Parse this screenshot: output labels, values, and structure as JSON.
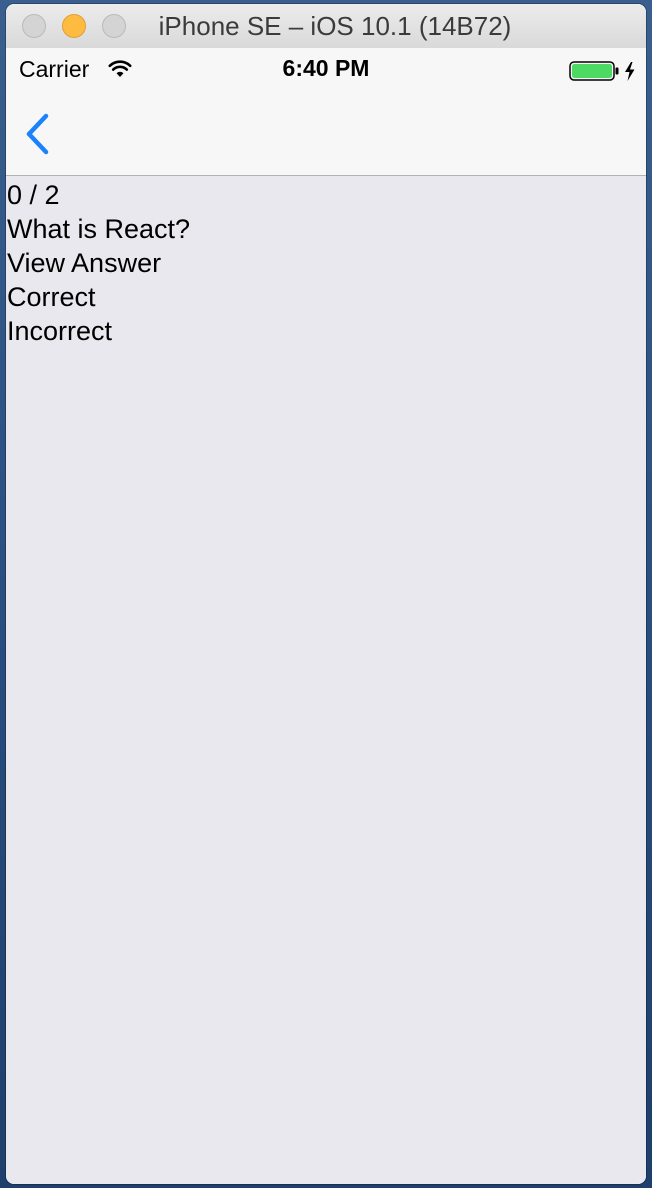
{
  "window": {
    "title": "iPhone SE – iOS 10.1 (14B72)"
  },
  "status_bar": {
    "carrier": "Carrier",
    "time": "6:40 PM",
    "wifi_icon": "wifi-icon",
    "battery_icon": "battery-charging-icon",
    "battery_level": 1.0
  },
  "nav_bar": {
    "back_icon": "chevron-left-icon",
    "accent_color": "#1a82fb"
  },
  "quiz": {
    "progress": "0 / 2",
    "question": "What is React?",
    "view_answer_label": "View Answer",
    "correct_label": "Correct",
    "incorrect_label": "Incorrect"
  },
  "colors": {
    "background": "#e9e8ee",
    "bar_background": "#f7f7f7",
    "battery_green": "#4cd964",
    "minimize_yellow": "#fdbc40"
  }
}
